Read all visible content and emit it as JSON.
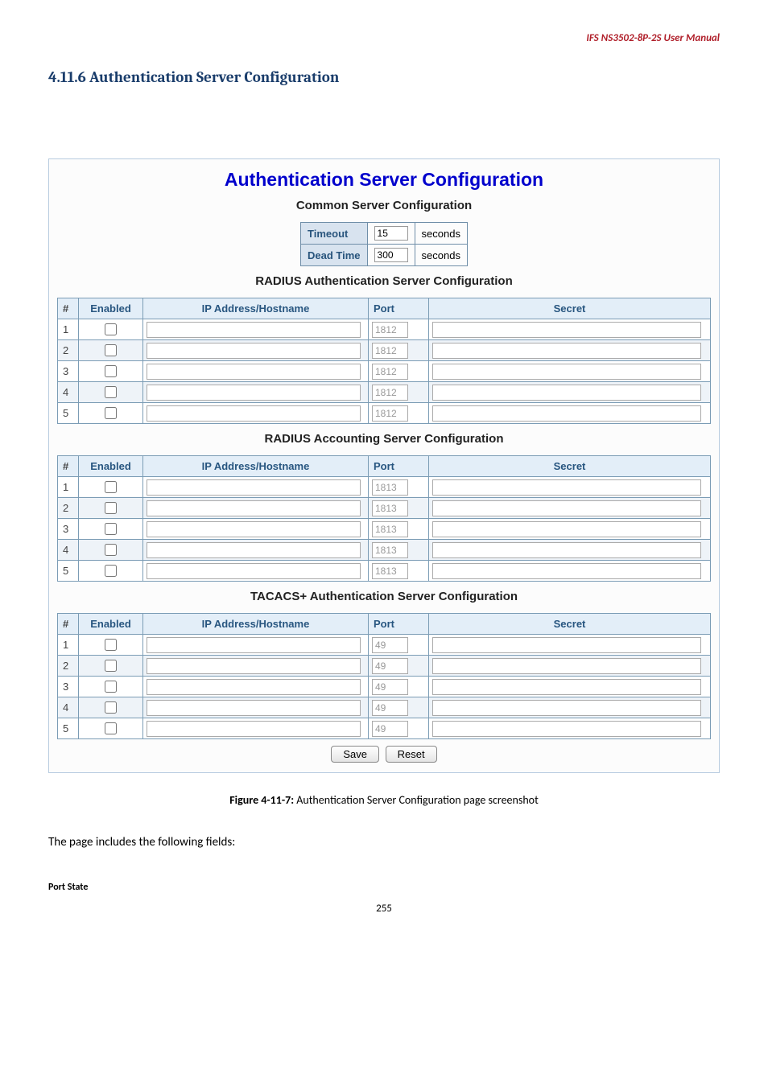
{
  "header": {
    "product": "IFS  NS3502-8P-2S  User  Manual"
  },
  "section": {
    "heading": "4.11.6 Authentication Server Configuration"
  },
  "panel": {
    "title": "Authentication Server Configuration",
    "common": {
      "heading": "Common Server Configuration",
      "timeout_label": "Timeout",
      "timeout_value": "15",
      "timeout_unit": "seconds",
      "deadtime_label": "Dead Time",
      "deadtime_value": "300",
      "deadtime_unit": "seconds"
    },
    "tables": [
      {
        "heading": "RADIUS Authentication Server Configuration",
        "cols": {
          "num": "#",
          "enabled": "Enabled",
          "host": "IP Address/Hostname",
          "port": "Port",
          "secret": "Secret"
        },
        "rows": [
          {
            "n": "1",
            "port": "1812"
          },
          {
            "n": "2",
            "port": "1812"
          },
          {
            "n": "3",
            "port": "1812"
          },
          {
            "n": "4",
            "port": "1812"
          },
          {
            "n": "5",
            "port": "1812"
          }
        ]
      },
      {
        "heading": "RADIUS Accounting Server Configuration",
        "cols": {
          "num": "#",
          "enabled": "Enabled",
          "host": "IP Address/Hostname",
          "port": "Port",
          "secret": "Secret"
        },
        "rows": [
          {
            "n": "1",
            "port": "1813"
          },
          {
            "n": "2",
            "port": "1813"
          },
          {
            "n": "3",
            "port": "1813"
          },
          {
            "n": "4",
            "port": "1813"
          },
          {
            "n": "5",
            "port": "1813"
          }
        ]
      },
      {
        "heading": "TACACS+ Authentication Server Configuration",
        "cols": {
          "num": "#",
          "enabled": "Enabled",
          "host": "IP Address/Hostname",
          "port": "Port",
          "secret": "Secret"
        },
        "rows": [
          {
            "n": "1",
            "port": "49"
          },
          {
            "n": "2",
            "port": "49"
          },
          {
            "n": "3",
            "port": "49"
          },
          {
            "n": "4",
            "port": "49"
          },
          {
            "n": "5",
            "port": "49"
          }
        ]
      }
    ],
    "buttons": {
      "save": "Save",
      "reset": "Reset"
    }
  },
  "figure": {
    "label": "Figure 4-11-7:",
    "text": " Authentication Server Configuration page screenshot"
  },
  "body": {
    "intro": "The page includes the following fields:",
    "port_state": "Port State"
  },
  "page": {
    "num": "255"
  }
}
